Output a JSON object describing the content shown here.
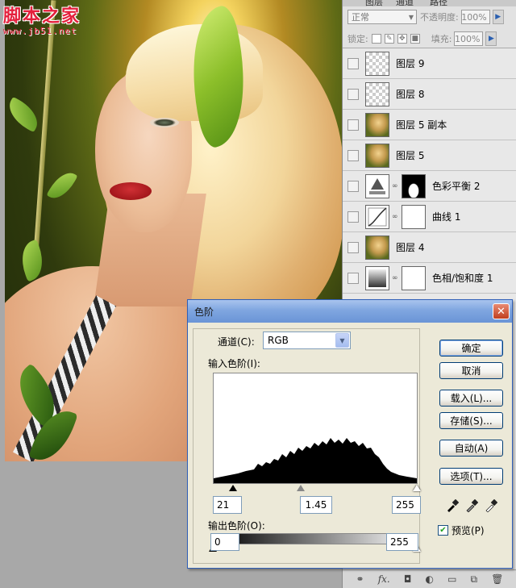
{
  "watermark": {
    "title": "脚本之家",
    "url": "www.jb51.net"
  },
  "layers_panel": {
    "tabs": [
      "图层",
      "通道",
      "路径"
    ],
    "blend_mode": "正常",
    "opacity_label": "不透明度:",
    "opacity_value": "100%",
    "lock_label": "锁定:",
    "fill_label": "填充:",
    "fill_value": "100%",
    "layers": [
      {
        "name": "图层 9",
        "thumb": "checker"
      },
      {
        "name": "图层 8",
        "thumb": "checker"
      },
      {
        "name": "图层 5 副本",
        "thumb": "photo"
      },
      {
        "name": "图层 5",
        "thumb": "photo"
      },
      {
        "name": "色彩平衡 2",
        "thumb": "adjustment-color-balance",
        "mask": "dark"
      },
      {
        "name": "曲线 1",
        "thumb": "adjustment-curves",
        "mask": "white"
      },
      {
        "name": "图层 4",
        "thumb": "photo"
      },
      {
        "name": "色相/饱和度 1",
        "thumb": "adjustment-hue-saturation",
        "mask": "white"
      }
    ],
    "footer_icons": [
      "link-icon",
      "fx-icon",
      "mask-icon",
      "adjustment-icon",
      "folder-icon",
      "new-layer-icon",
      "trash-icon"
    ]
  },
  "levels_dialog": {
    "title": "色阶",
    "channel_label": "通道(C):",
    "channel_value": "RGB",
    "input_label": "输入色阶(I):",
    "input_black": "21",
    "input_gamma": "1.45",
    "input_white": "255",
    "output_label": "输出色阶(O):",
    "output_black": "0",
    "output_white": "255",
    "buttons": {
      "ok": "确定",
      "cancel": "取消",
      "load": "载入(L)...",
      "save": "存储(S)...",
      "auto": "自动(A)",
      "options": "选项(T)..."
    },
    "preview_label": "预览(P)",
    "preview_checked": true,
    "close_glyph": "✕"
  }
}
